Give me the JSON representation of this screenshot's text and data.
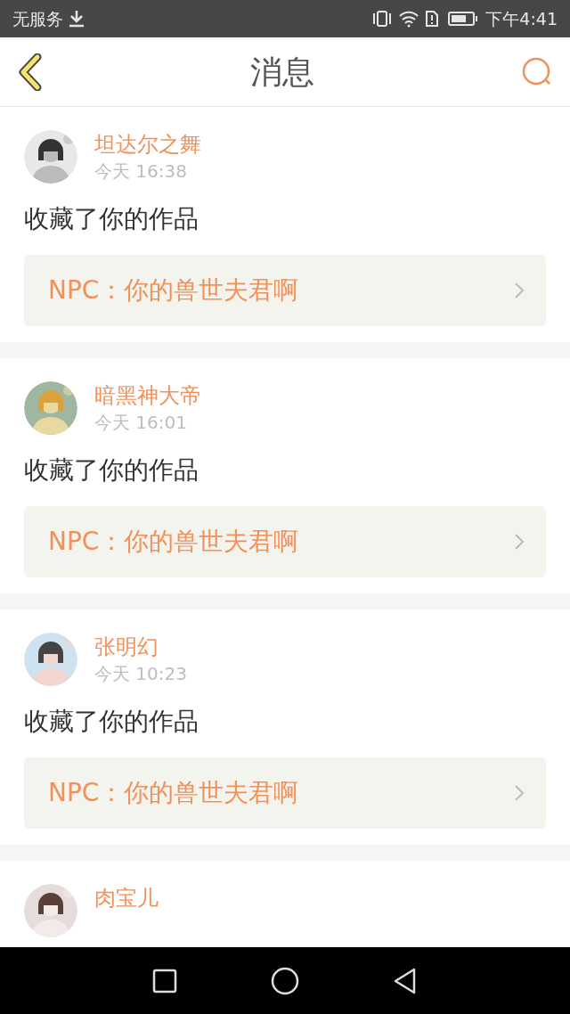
{
  "status_bar": {
    "carrier": "无服务",
    "time": "下午4:41"
  },
  "header": {
    "title": "消息"
  },
  "messages": [
    {
      "name": "坦达尔之舞",
      "time": "今天 16:38",
      "action": "收藏了你的作品",
      "work": "NPC：你的兽世夫君啊"
    },
    {
      "name": "暗黑神大帝",
      "time": "今天 16:01",
      "action": "收藏了你的作品",
      "work": "NPC：你的兽世夫君啊"
    },
    {
      "name": "张明幻",
      "time": "今天 10:23",
      "action": "收藏了你的作品",
      "work": "NPC：你的兽世夫君啊"
    },
    {
      "name": "肉宝儿"
    }
  ]
}
